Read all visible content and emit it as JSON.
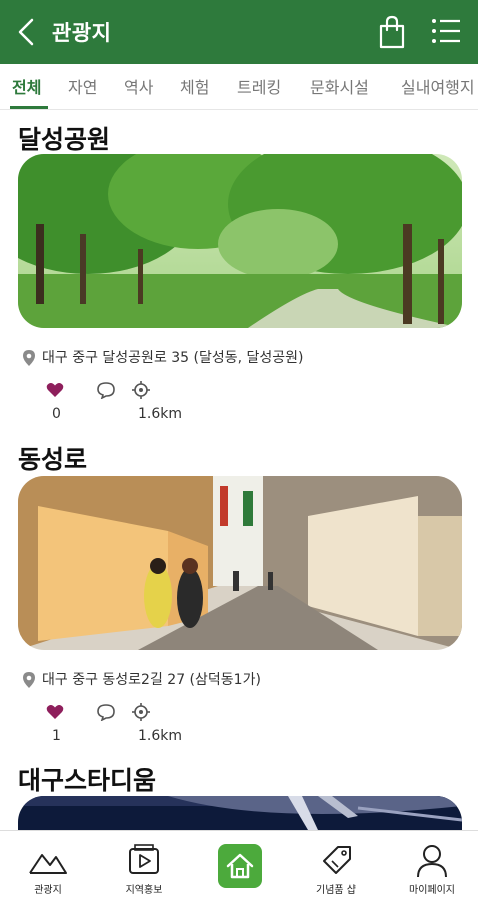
{
  "header": {
    "title": "관광지",
    "back_icon": "chevron-left-icon",
    "bag_icon": "shopping-bag-icon",
    "menu_icon": "list-menu-icon",
    "bg_color": "#2e7a3c"
  },
  "tabs": [
    {
      "label": "전체",
      "active": true
    },
    {
      "label": "자연",
      "active": false
    },
    {
      "label": "역사",
      "active": false
    },
    {
      "label": "체험",
      "active": false
    },
    {
      "label": "트레킹",
      "active": false
    },
    {
      "label": "문화시설",
      "active": false
    },
    {
      "label": "실내여행지",
      "active": false
    }
  ],
  "places": [
    {
      "name": "달성공원",
      "address": "대구 중구 달성공원로 35 (달성동, 달성공원)",
      "likes": "0",
      "distance": "1.6km"
    },
    {
      "name": "동성로",
      "address": "대구 중구 동성로2길 27 (삼덕동1가)",
      "likes": "1",
      "distance": "1.6km"
    },
    {
      "name": "대구스타디움"
    }
  ],
  "bottom_nav": [
    {
      "label": "관광지",
      "icon": "mountain-icon"
    },
    {
      "label": "지역홍보",
      "icon": "video-play-icon"
    },
    {
      "label": "",
      "icon": "home-icon"
    },
    {
      "label": "기념품 샵",
      "icon": "tag-icon"
    },
    {
      "label": "마이페이지",
      "icon": "user-icon"
    }
  ],
  "colors": {
    "accent": "#2e7a3c",
    "home_button": "#4caa3c",
    "heart": "#8e1f5c"
  }
}
